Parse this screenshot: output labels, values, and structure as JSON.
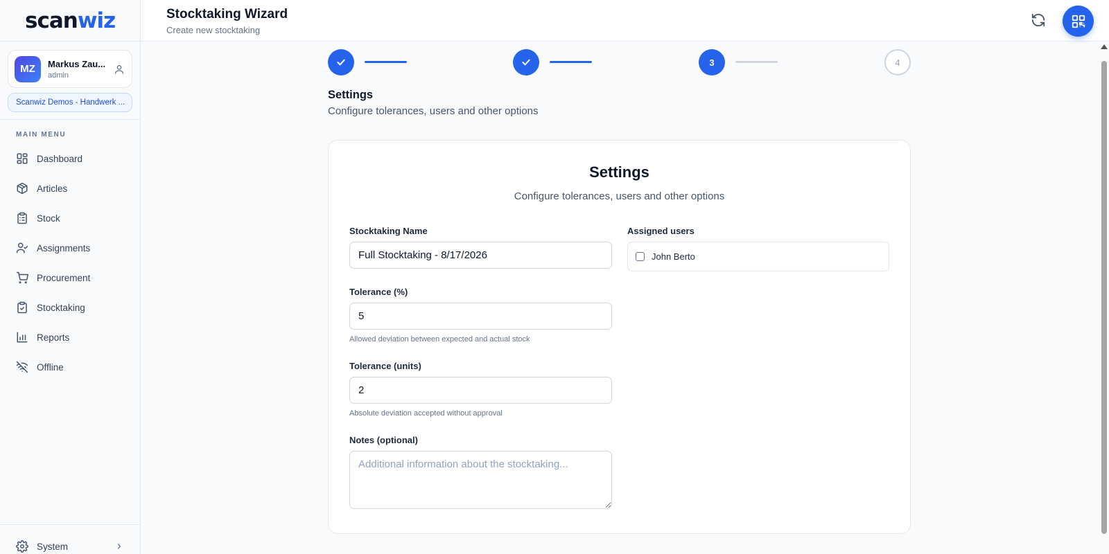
{
  "brand": {
    "part1": "scan",
    "part2": "wiz"
  },
  "user": {
    "initials": "MZ",
    "name": "Markus Zau...",
    "role": "admin"
  },
  "organization": "Scanwiz Demos - Handwerk ...",
  "sidebar": {
    "menu_label": "MAIN MENU",
    "items": [
      {
        "label": "Dashboard",
        "icon": "dashboard-icon"
      },
      {
        "label": "Articles",
        "icon": "package-icon"
      },
      {
        "label": "Stock",
        "icon": "clipboard-list-icon"
      },
      {
        "label": "Assignments",
        "icon": "user-check-icon"
      },
      {
        "label": "Procurement",
        "icon": "cart-icon"
      },
      {
        "label": "Stocktaking",
        "icon": "clipboard-check-icon"
      },
      {
        "label": "Reports",
        "icon": "bar-chart-icon"
      },
      {
        "label": "Offline",
        "icon": "wifi-off-icon"
      }
    ],
    "system_label": "System"
  },
  "header": {
    "title": "Stocktaking Wizard",
    "subtitle": "Create new stocktaking"
  },
  "stepper": {
    "current_label": "3",
    "next_label": "4",
    "section_title": "Settings",
    "section_subtitle": "Configure tolerances, users and other options"
  },
  "card": {
    "title": "Settings",
    "subtitle": "Configure tolerances, users and other options",
    "name_label": "Stocktaking Name",
    "name_value": "Full Stocktaking - 8/17/2026",
    "tolerance_pct_label": "Tolerance (%)",
    "tolerance_pct_value": "5",
    "tolerance_pct_hint": "Allowed deviation between expected and actual stock",
    "tolerance_units_label": "Tolerance (units)",
    "tolerance_units_value": "2",
    "tolerance_units_hint": "Absolute deviation accepted without approval",
    "notes_label": "Notes (optional)",
    "notes_placeholder": "Additional information about the stocktaking...",
    "assigned_label": "Assigned users",
    "users": [
      {
        "name": "John Berto",
        "checked": false
      }
    ]
  },
  "colors": {
    "accent": "#2563eb",
    "text": "#0f172a",
    "muted": "#64748b"
  }
}
